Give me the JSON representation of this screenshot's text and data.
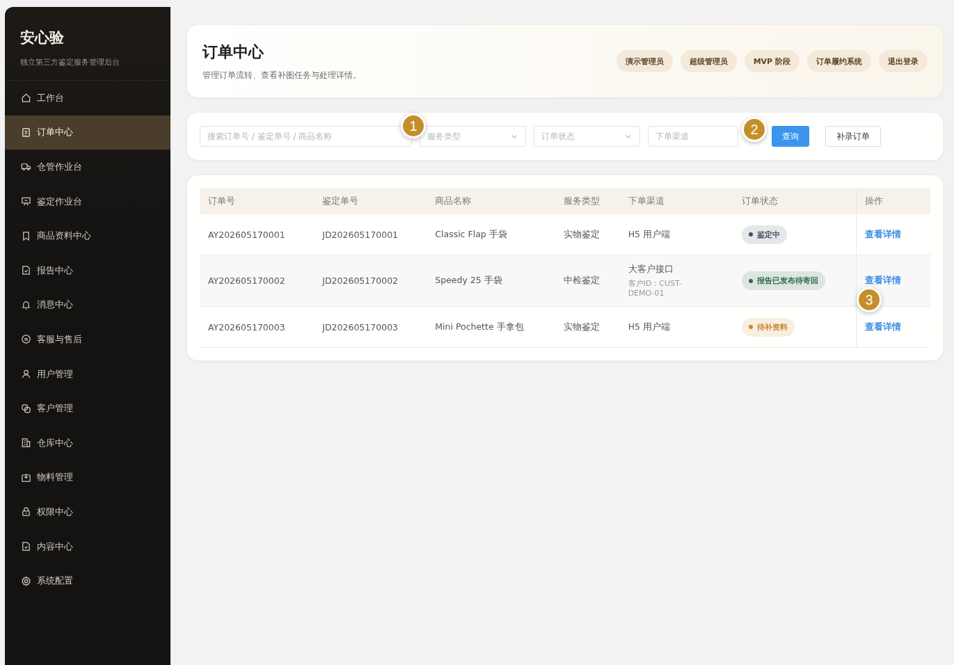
{
  "sidebar": {
    "brand": "安心验",
    "subtitle": "独立第三方鉴定服务管理后台",
    "items": [
      {
        "label": "工作台",
        "kind": "home",
        "selected": false
      },
      {
        "label": "订单中心",
        "kind": "doc",
        "selected": true
      },
      {
        "label": "仓管作业台",
        "kind": "truck",
        "selected": false
      },
      {
        "label": "鉴定作业台",
        "kind": "board",
        "selected": false
      },
      {
        "label": "商品资料中心",
        "kind": "bookmark",
        "selected": false
      },
      {
        "label": "报告中心",
        "kind": "check",
        "selected": false
      },
      {
        "label": "消息中心",
        "kind": "bell",
        "selected": false
      },
      {
        "label": "客服与售后",
        "kind": "chat",
        "selected": false
      },
      {
        "label": "用户管理",
        "kind": "user",
        "selected": false
      },
      {
        "label": "客户管理",
        "kind": "link",
        "selected": false
      },
      {
        "label": "仓库中心",
        "kind": "building",
        "selected": false
      },
      {
        "label": "物料管理",
        "kind": "box",
        "selected": false
      },
      {
        "label": "权限中心",
        "kind": "lock",
        "selected": false
      },
      {
        "label": "内容中心",
        "kind": "check",
        "selected": false
      },
      {
        "label": "系统配置",
        "kind": "gear",
        "selected": false
      }
    ]
  },
  "header": {
    "title": "订单中心",
    "subtitle": "管理订单流转、查看补图任务与处理详情。",
    "chips": [
      "演示管理员",
      "超级管理员",
      "MVP 阶段",
      "订单履约系统",
      "退出登录"
    ]
  },
  "filters": {
    "search": {
      "placeholder": "搜索订单号 / 鉴定单号 / 商品名称"
    },
    "selects": [
      {
        "placeholder": "服务类型"
      },
      {
        "placeholder": "订单状态"
      }
    ],
    "channel": {
      "placeholder": "下单渠道"
    },
    "query_button": "查询",
    "add_button": "补录订单"
  },
  "table": {
    "columns": [
      "订单号",
      "鉴定单号",
      "商品名称",
      "服务类型",
      "下单渠道",
      "订单状态",
      "操作"
    ],
    "rows": [
      {
        "order": "AY202605170001",
        "appraisal": "JD202605170001",
        "product": "Classic Flap 手袋",
        "service": "实物鉴定",
        "channel": "H5 用户端",
        "status": {
          "label": "鉴定中",
          "color": "#3f4f66"
        },
        "action": "查看详情"
      },
      {
        "order": "AY202605170002",
        "appraisal": "JD202605170002",
        "product": "Speedy 25 手袋",
        "service": "中检鉴定",
        "channel": "大客户接口",
        "channel_note": "客户ID：CUST-DEMO-01",
        "status": {
          "label": "报告已发布待寄回",
          "color": "#2e6b4a"
        },
        "action": "查看详情"
      },
      {
        "order": "AY202605170003",
        "appraisal": "JD202605170003",
        "product": "Mini Pochette 手拿包",
        "service": "实物鉴定",
        "channel": "H5 用户端",
        "status": {
          "label": "待补资料",
          "color": "#c8892e"
        },
        "action": "查看详情"
      }
    ]
  },
  "callouts": [
    "1",
    "2",
    "3"
  ]
}
